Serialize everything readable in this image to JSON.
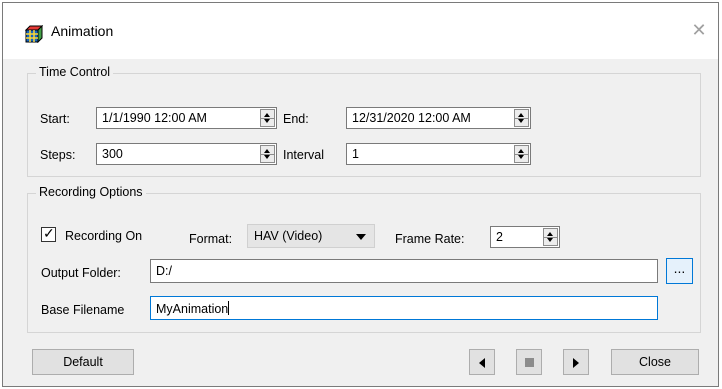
{
  "window": {
    "title": "Animation"
  },
  "time_control": {
    "label": "Time Control",
    "start_label": "Start:",
    "start_value": "1/1/1990 12:00 AM",
    "end_label": "End:",
    "end_value": "12/31/2020 12:00 AM",
    "steps_label": "Steps:",
    "steps_value": "300",
    "interval_label": "Interval",
    "interval_value": "1"
  },
  "recording": {
    "label": "Recording Options",
    "recording_on_label": "Recording On",
    "recording_on_checked": true,
    "format_label": "Format:",
    "format_value": "HAV (Video)",
    "frame_rate_label": "Frame Rate:",
    "frame_rate_value": "2",
    "output_folder_label": "Output Folder:",
    "output_folder_value": "D:/",
    "browse_label": "...",
    "base_filename_label": "Base Filename",
    "base_filename_value": "MyAnimation"
  },
  "buttons": {
    "default_label": "Default",
    "close_label": "Close"
  },
  "icons": {
    "app": "cube-icon",
    "close": "close-icon",
    "prev": "step-back-icon",
    "stop": "stop-icon",
    "next": "play-icon",
    "check": "check-icon"
  }
}
